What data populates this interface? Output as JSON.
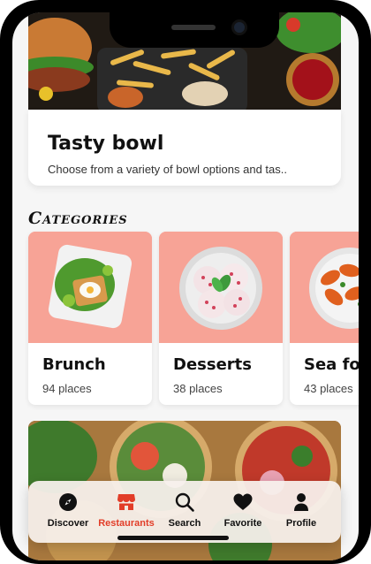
{
  "hero": {
    "title": "Tasty bowl",
    "description": "Choose from a variety of bowl options and tas.."
  },
  "categories_title": "Categories",
  "categories": [
    {
      "name": "Brunch",
      "count": "94 places",
      "icon": "brunch-plate-image"
    },
    {
      "name": "Desserts",
      "count": "38 places",
      "icon": "ice-cream-bowl-image"
    },
    {
      "name": "Sea food",
      "count": "43 places",
      "icon": "shrimp-bowl-image"
    }
  ],
  "nav": {
    "items": [
      {
        "label": "Discover",
        "icon": "compass-icon",
        "active": false
      },
      {
        "label": "Restaurants",
        "icon": "storefront-icon",
        "active": true
      },
      {
        "label": "Search",
        "icon": "search-icon",
        "active": false
      },
      {
        "label": "Favorite",
        "icon": "heart-icon",
        "active": false
      },
      {
        "label": "Profile",
        "icon": "person-icon",
        "active": false
      }
    ]
  },
  "colors": {
    "accent": "#e23d28",
    "category_bg": "#f7a396",
    "text": "#111111"
  }
}
